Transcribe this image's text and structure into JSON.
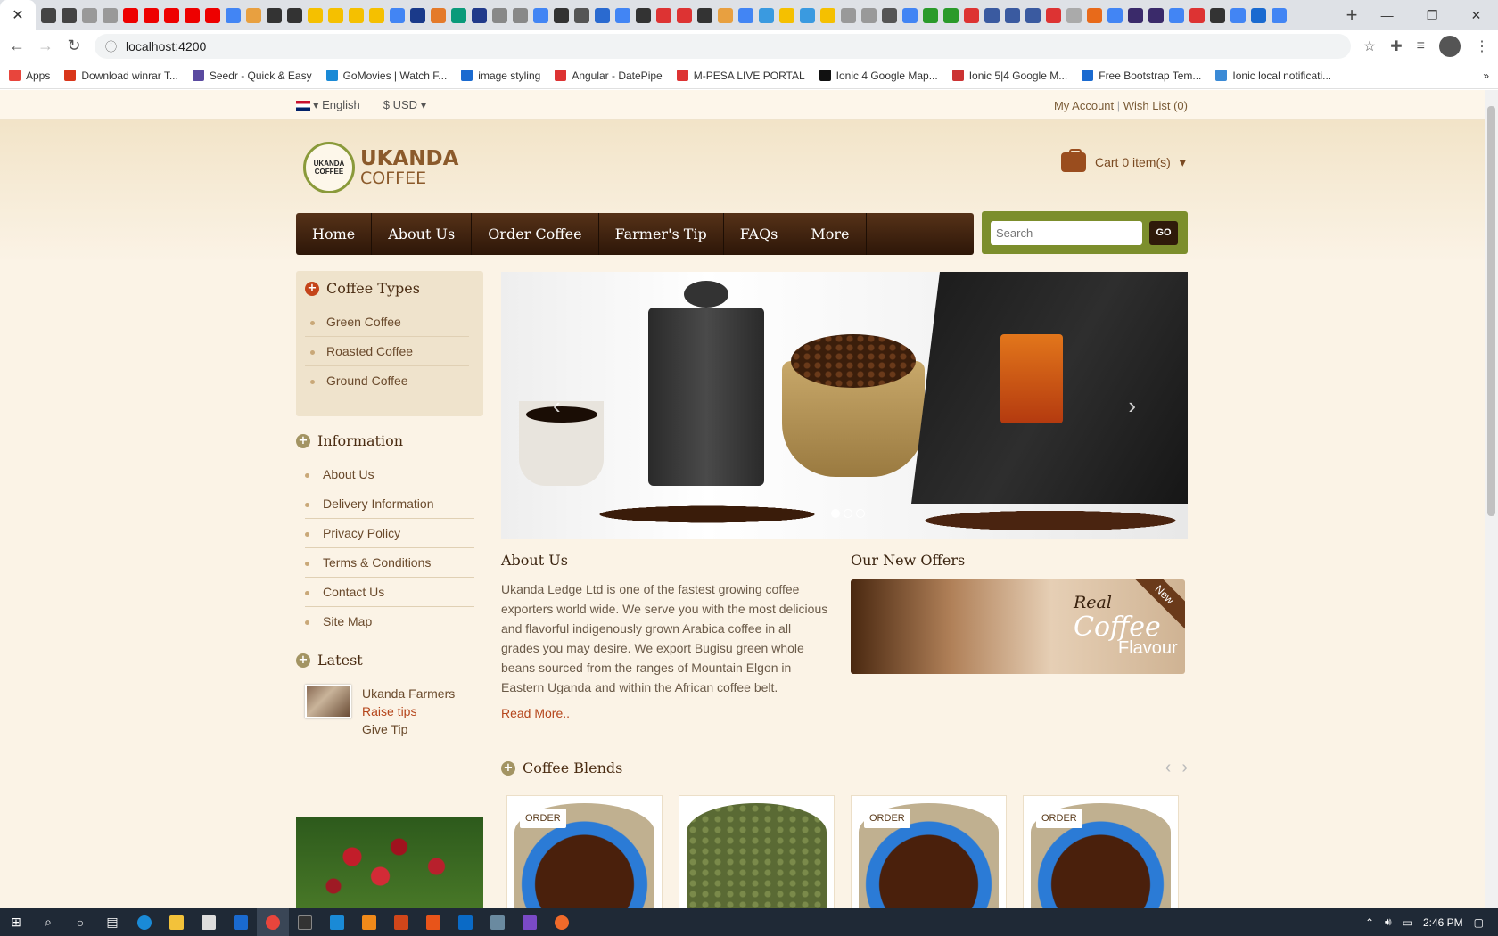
{
  "browser": {
    "active_tab_close": "✕",
    "new_tab": "+",
    "window_controls": [
      "—",
      "❐",
      "✕"
    ],
    "url": "localhost:4200",
    "favicon_colors": [
      "#444",
      "#444",
      "#999",
      "#999",
      "#e00",
      "#e00",
      "#e00",
      "#e00",
      "#e00",
      "#4285f4",
      "#e8a040",
      "#333",
      "#333",
      "#f5c000",
      "#f5c000",
      "#f5c000",
      "#f5c000",
      "#4285f4",
      "#1a3a8a",
      "#e47a2a",
      "#0a9a7a",
      "#223a8a",
      "#888",
      "#888",
      "#4285f4",
      "#333",
      "#555",
      "#2a6ad0",
      "#4285f4",
      "#333",
      "#d33",
      "#d33",
      "#333",
      "#e8a040",
      "#4285f4",
      "#3a9ae0",
      "#f5c000",
      "#3a9ae0",
      "#f5c000",
      "#999",
      "#999",
      "#555",
      "#4285f4",
      "#2a9a2a",
      "#2a9a2a",
      "#d33",
      "#3a5aa0",
      "#3a5aa0",
      "#3a5aa0",
      "#d33",
      "#aaa",
      "#e86a1a",
      "#4285f4",
      "#3a2a6a",
      "#3a2a6a",
      "#4285f4",
      "#d33",
      "#333",
      "#4285f4",
      "#1a6ad0",
      "#4285f4"
    ],
    "bookmarks": [
      {
        "label": "Apps",
        "color": "#e8453c"
      },
      {
        "label": "Download winrar T...",
        "color": "#d9361a"
      },
      {
        "label": "Seedr - Quick & Easy",
        "color": "#5a4aa0"
      },
      {
        "label": "GoMovies | Watch F...",
        "color": "#1a8ad6"
      },
      {
        "label": "image styling",
        "color": "#1a6ad0"
      },
      {
        "label": "Angular - DatePipe",
        "color": "#d33"
      },
      {
        "label": "M-PESA LIVE PORTAL",
        "color": "#d33"
      },
      {
        "label": "Ionic 4 Google Map...",
        "color": "#111"
      },
      {
        "label": "Ionic 5|4 Google M...",
        "color": "#c33"
      },
      {
        "label": "Free Bootstrap Tem...",
        "color": "#1a6ad0"
      },
      {
        "label": "Ionic local notificati...",
        "color": "#3a8ad6"
      }
    ],
    "bookmarks_more": "»"
  },
  "site": {
    "language": "English",
    "currency": "$ USD",
    "my_account": "My Account",
    "wish_list": "Wish List (0)",
    "logo_line1": "UKANDA",
    "logo_line2": "COFFEE",
    "logo_badge": "UKANDA COFFEE",
    "cart": "Cart 0 item(s)",
    "nav": [
      "Home",
      "About Us",
      "Order Coffee",
      "Farmer's Tip",
      "FAQs",
      "More"
    ],
    "search_placeholder": "Search",
    "search_button": "GO",
    "coffee_types": {
      "title": "Coffee Types",
      "items": [
        "Green Coffee",
        "Roasted Coffee",
        "Ground Coffee"
      ]
    },
    "information": {
      "title": "Information",
      "items": [
        "About Us",
        "Delivery Information",
        "Privacy Policy",
        "Terms & Conditions",
        "Contact Us",
        "Site Map"
      ]
    },
    "latest": {
      "title": "Latest",
      "line1": "Ukanda Farmers",
      "line2": "Raise tips",
      "line3": "Give Tip"
    },
    "about": {
      "title": "About Us",
      "text": "Ukanda Ledge Ltd is one of the fastest growing coffee exporters world wide. We serve you with the most delicious and flavorful indigenously grown Arabica coffee in all grades you may desire. We export Bugisu green whole beans sourced from the ranges of Mountain Elgon in Eastern Uganda and within the African coffee belt.",
      "read_more": "Read More.."
    },
    "offers": {
      "title": "Our New Offers",
      "badge": "New",
      "line1": "Real",
      "line2": "Coffee",
      "line3": "Flavour"
    },
    "blends": {
      "title": "Coffee Blends",
      "order_label": "ORDER"
    }
  },
  "taskbar": {
    "time": "2:46 PM"
  }
}
